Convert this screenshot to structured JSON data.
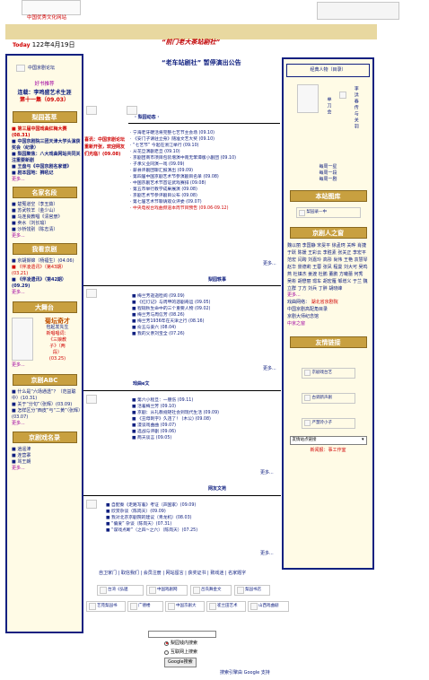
{
  "header": {
    "logo_caption": "中国优秀文化网站",
    "today_label": "Today",
    "date": "122年4月19日",
    "site_name": "“前门老大茶站剧社”",
    "notice_title": "“老车站剧社” 暂停演出公告"
  },
  "left": {
    "forum_link": "中国京剧论坛",
    "hot_recommend": "好书推荐",
    "serial_title": "连载：李鸣盛艺术生涯",
    "serial_episode": "第十一集（09.03）",
    "sections": [
      {
        "title": "梨园荟萃",
        "items": [
          {
            "text": "■ 第三届中国戏曲红梅大赛(08.31)",
            "red": true
          },
          {
            "text": "■ 中国京剧院三团天津大学头演获奖会（纪录）",
            "red": false
          },
          {
            "text": "■ 梨园聚焦：八大戏曲网站共同关注重要新剧",
            "red": false
          },
          {
            "text": "■ 王盘与《中国京剧名家谱》",
            "red": false
          },
          {
            "text": "■ 剧本园地：狮吼记",
            "red": false
          }
        ],
        "more": "更多..."
      },
      {
        "title": "名家名段",
        "items": [
          {
            "text": "■ 楚冤道空（李玉茹）"
          },
          {
            "text": "■ 苏武牧羊（金少山）"
          },
          {
            "text": "■ 马连良教唱《清官册》"
          },
          {
            "text": "■ 卖水（刘长瑜）"
          },
          {
            "text": "■ 沙桥饯别（陈志清）"
          }
        ],
        "more": "更多..."
      },
      {
        "title": "我看京剧",
        "items": [
          {
            "text": "■ 京胡撷锦（杨福生）(04.06)",
            "red": false
          },
          {
            "text": "■ 《伴凌遗讯》（第43期）(03.21)",
            "red": true
          },
          {
            "text": "■ 《伴凌遗讯》（第42期）(09.29)",
            "red": false
          }
        ],
        "more": "更多..."
      },
      {
        "title": "大舞台",
        "feature_title": "菊坛奇才",
        "feature_lines": [
          "包起发先生",
          "新唱唱词：",
          "《三娘教",
          "子》（两",
          "段）",
          "(03.25)"
        ],
        "more": "更多..."
      },
      {
        "title": "京剧ABC",
        "items": [
          {
            "text": "■ 什么是“六场通透”？（范益聪中）(10.31)"
          },
          {
            "text": "■ 关于“分句”（张辉）(03.09)"
          },
          {
            "text": "■ 怎样区分“西皮”与“二黄”（张辉）(03.07)"
          }
        ],
        "more": "更多..."
      },
      {
        "title": "京剧戏名录",
        "items": [
          {
            "text": "■ 逍遥津"
          },
          {
            "text": "■ 连营寨"
          },
          {
            "text": "■ 骂王朗"
          }
        ],
        "more": "更多..."
      }
    ]
  },
  "center": {
    "sidebar_promo": "喜讯：中国京剧论坛重新开张，欢迎网友们光临！(09.08)",
    "sec1": {
      "label": "· 梨园动态 ·",
      "items": [
        "· 宁海老牙硬活将完整七艺节主会场 (09.10)",
        "· 《安门子请驻立身》随准文艺大奖 (09.10)",
        "· “七艺节” 今起在浙江举行 (09.10)",
        "· 从花旦演剧老旦 (09.10)",
        "· 京剧团商市项目包装增演中南无笨谭版小剧团 (09.10)",
        "· 子承父业同演一戏 (09.09)",
        "· 薪县评剧团聊汇报演出 (09.09)",
        "· 第四届中国京剧艺术节参演剧目名单 (09.08)",
        "· 中国京剧艺术节首证武戏赛排 (09.08)",
        "· 第五市举行教学成果展演 (09.08)",
        "· 京剧艺术节参评剧目公布 (09.08)",
        "· 第七届艺术节聊请观众评委 (09.07)",
        "· 中央电视台戏曲频道本周节目预告 (09.06-09.12)"
      ],
      "more": "更多..."
    },
    "sec2": {
      "label": "梨园轶事",
      "items": [
        "■ 梅兰芳逝逝检阅 (09.09)",
        "■ 《红灯记》与周甲的悲剧奇运 (09.05)",
        "■ 程砚秋生命中的三个重要人物 (09.02)",
        "■ 梅兰芳与周信芳 (08.26)",
        "■ 梅兰芳1936年在天津之行 (08.16)",
        "■ 俞五与姜六 (08.04)",
        "■ 我的父亲刘宝全 (07.26)"
      ],
      "more": "更多..."
    },
    "sec3": {
      "label": "戏曲e文",
      "items": [
        "■ 第六小程旦：一朋伤 (09.11)",
        "■ 活着梅兰芳 (09.10)",
        "■ 京剧：从礼教规矩社会到现代生活 (09.09)",
        "■ 《丑母刺字》久违了！ (木公) (09.08)",
        "■ 漫谈戏曲曲 (09.07)",
        "■ 选战与评剧 (09.06)",
        "■ 两天谈言 (09.05)"
      ],
      "more": "更多..."
    },
    "sec4": {
      "label": "网友文苑",
      "items": [
        "■ 自配秦《走路写着》考证（声国家）(09.09)",
        "■ 欣赏杂谈（陈岗天）(09.09)",
        "■ 我对北京京剧院的建议（青龙机）(08.03)",
        "■ “偏爱” 杂谈（陈岗天）(07.31)",
        "■ “谋戏点断”（之四~之六）（陈岗天）(07.25)"
      ],
      "more": "更多..."
    },
    "footer_links": "自卫家门 | 取信我们 | 会员注册 | 网站留言 | 获奖证书 | 致戏迷 | 名家题字",
    "partner_row1": [
      "台湾《弘邈",
      "中国戏剧网",
      "吕氏舞金文",
      "梨园书店"
    ],
    "partner_row2": [
      "艺苑梨园书",
      "广德楼",
      "中国京剧大",
      "崔兰田艺术",
      "山西戏曲剧"
    ]
  },
  "right": {
    "person_label": "经典人物（目录）",
    "person_name_v": "单刀会",
    "person_desc_v": "李洪春传与关羽",
    "daily_items": [
      "每周一星",
      "每周一段",
      "每周一剧"
    ],
    "sections": [
      {
        "title": "本站图库",
        "link": "梨园录—中"
      },
      {
        "title": "京剧人之窗"
      }
    ],
    "names": "魏以丽 李国静 宋旻平 徐孟珂 关晔 肖捷 于跃 陈媛 王彩云 李胜素 张关正 李宏平 范宏 闫跨 刘嘉玲 高彤 尚伟 王艳 袁慧琴 赵华 景德莉 王蓉 张凤 程曼 刘大可 吴鸣燕 杜镇杰 姜渡 杜鹏 董鹏 方曦蕾 何秀 吴彬 胡懋丽 璟车 胡宏雁 邹增义 于兰 魏立群 丁方 刘兵 丁胖 胡晓峰",
    "more": "更多...",
    "network_title": "戏曲网络：",
    "network_value": "湖北省京剧院",
    "network_items": [
      "中国京剧高配角目录",
      "京剧大师纪念馆",
      "中京之窗"
    ],
    "friend_links_title": "友情链接",
    "friend_links": [
      "京剧戏台艺",
      "古调新声剧",
      "严慧玲小子"
    ],
    "select_label": "友情站点链接",
    "sponsor_label": "新闻报：事工作室"
  },
  "search": {
    "option1": "梨园钱内搜索",
    "option2": "互联网上搜索",
    "button": "Google搜索",
    "powered": "搜索引擎由 Google 支持"
  }
}
